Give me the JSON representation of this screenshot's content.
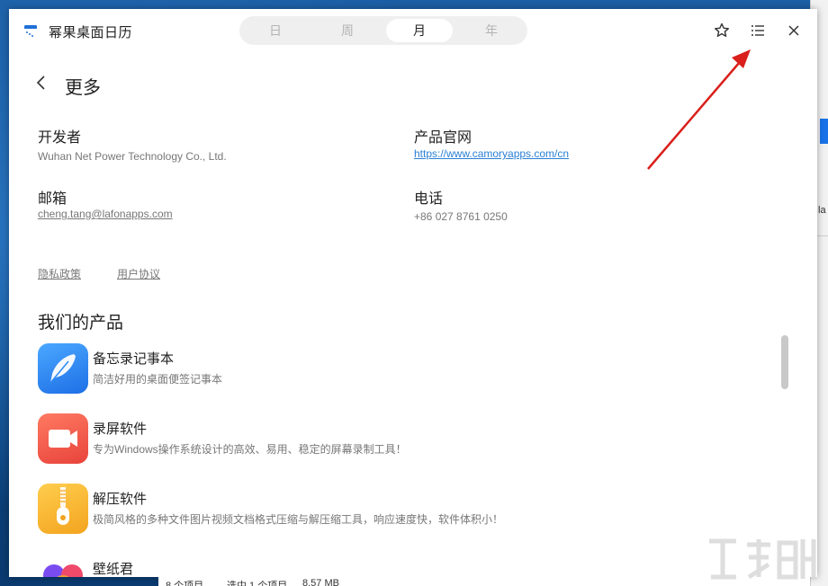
{
  "app": {
    "title": "幂果桌面日历",
    "view_tabs": [
      {
        "label": "日",
        "active": false
      },
      {
        "label": "周",
        "active": false
      },
      {
        "label": "月",
        "active": true
      },
      {
        "label": "年",
        "active": false
      }
    ],
    "icons": [
      "star-icon",
      "list-menu-icon",
      "close-icon"
    ]
  },
  "page": {
    "title": "更多",
    "developer": {
      "label": "开发者",
      "value": "Wuhan Net Power Technology Co., Ltd."
    },
    "website": {
      "label": "产品官网",
      "value": "https://www.camoryapps.com/cn"
    },
    "email": {
      "label": "邮箱",
      "value": "cheng.tang@lafonapps.com"
    },
    "phone": {
      "label": "电话",
      "value": "+86 027 8761 0250"
    },
    "privacy_link": "隐私政策",
    "user_agreement_link": "用户协议",
    "products_title": "我们的产品",
    "products": [
      {
        "name": "备忘录记事本",
        "desc": "简洁好用的桌面便签记事本",
        "icon": "feather-icon",
        "color": "#2f8cf5"
      },
      {
        "name": "录屏软件",
        "desc": "专为Windows操作系统设计的高效、易用、稳定的屏幕录制工具！",
        "icon": "video-camera-icon",
        "color": "#f0574a"
      },
      {
        "name": "解压软件",
        "desc": "极简风格的多种文件图片视频文档格式压缩与解压缩工具，响应速度快，软件体积小！",
        "icon": "zipper-icon",
        "color": "#f6b630"
      },
      {
        "name": "壁纸君",
        "desc": "",
        "icon": "heart-petals-icon",
        "color": "#e8416e"
      }
    ]
  },
  "explorer_status": {
    "item_count": "8 个项目",
    "selected": "选中 1 个项目",
    "size": "8.57 MB"
  },
  "background_window": {
    "text": "la"
  },
  "colors": {
    "accent": "#2a7fd4",
    "arrow": "#d9201c"
  }
}
